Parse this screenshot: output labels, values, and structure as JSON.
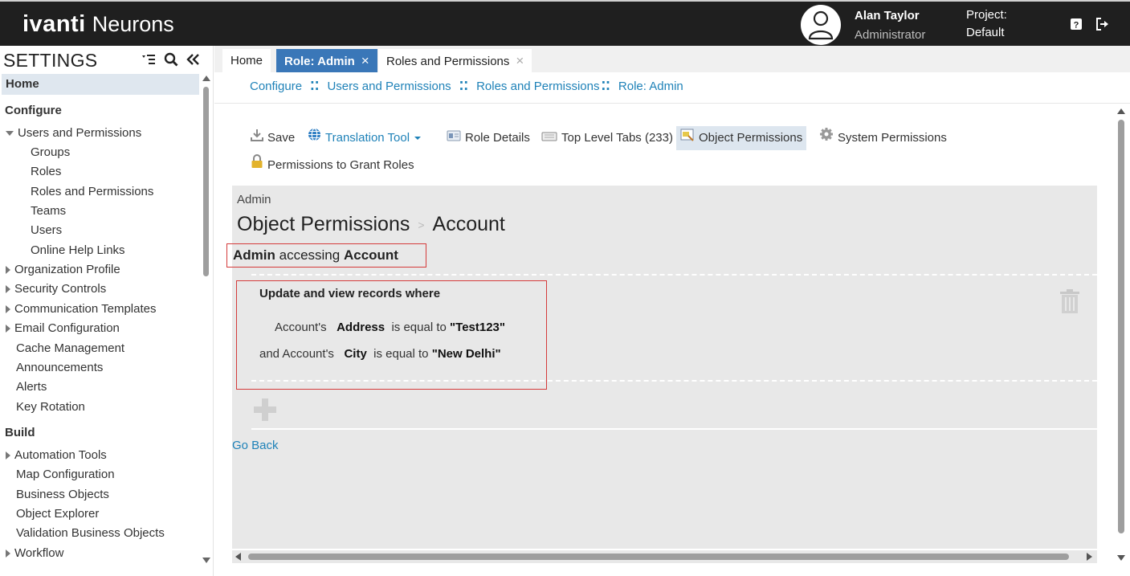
{
  "header": {
    "brand": "ivanti",
    "product": "Neurons",
    "user_name": "Alan Taylor",
    "user_role": "Administrator",
    "project_label": "Project:",
    "project_value": "Default",
    "icons": [
      "user-avatar-icon",
      "help-icon",
      "logout-icon"
    ]
  },
  "sidebar": {
    "title": "SETTINGS",
    "home": "Home",
    "configure_section": "Configure",
    "configure_items": {
      "users_and_permissions": "Users and Permissions",
      "groups": "Groups",
      "roles": "Roles",
      "roles_and_permissions": "Roles and Permissions",
      "teams": "Teams",
      "users": "Users",
      "online_help_links": "Online Help Links",
      "organization_profile": "Organization Profile",
      "security_controls": "Security Controls",
      "communication_templates": "Communication Templates",
      "email_configuration": "Email Configuration",
      "cache_management": "Cache Management",
      "announcements": "Announcements",
      "alerts": "Alerts",
      "key_rotation": "Key Rotation"
    },
    "build_section": "Build",
    "build_items": {
      "automation_tools": "Automation Tools",
      "map_configuration": "Map Configuration",
      "business_objects": "Business Objects",
      "object_explorer": "Object Explorer",
      "validation_business_objects": "Validation Business Objects",
      "workflow": "Workflow"
    }
  },
  "tabs": {
    "home": "Home",
    "role_admin": "Role: Admin",
    "roles_and_permissions": "Roles and Permissions",
    "close_glyph": "×"
  },
  "breadcrumb": {
    "configure": "Configure",
    "users_and_permissions": "Users and Permissions",
    "roles_and_permissions": "Roles and Permissions",
    "role_admin": "Role: Admin",
    "separator": "⁚⁚"
  },
  "toolbar": {
    "save": "Save",
    "translation_tool": "Translation Tool",
    "role_details": "Role Details",
    "top_level_tabs": "Top Level Tabs (233)",
    "object_permissions": "Object Permissions",
    "system_permissions": "System Permissions",
    "permissions_to_grant_roles": "Permissions to Grant Roles"
  },
  "panel": {
    "role": "Admin",
    "title": "Object Permissions",
    "object": "Account",
    "access_role": "Admin",
    "access_word": "accessing",
    "access_object": "Account",
    "rule_heading": "Update and view records where",
    "cond1_prefix": "Account's",
    "cond1_field": "Address",
    "cond1_op": "is equal to",
    "cond1_value": "\"Test123\"",
    "cond2_prefix": "and Account's",
    "cond2_field": "City",
    "cond2_op": "is equal to",
    "cond2_value": "\"New Delhi\"",
    "go_back": "Go Back"
  },
  "colors": {
    "header_bg": "#1f1f1f",
    "active_tab": "#3a77b8",
    "link": "#1f82b8",
    "highlight_border": "#d43b3b",
    "panel_bg": "#e8e8e8"
  }
}
